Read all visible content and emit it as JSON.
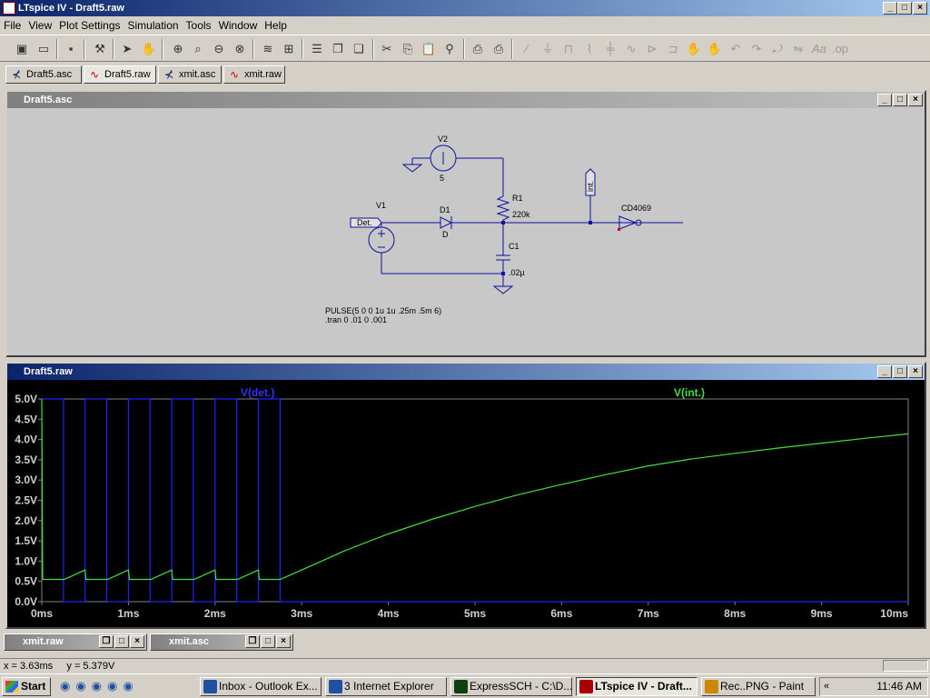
{
  "app": {
    "title": "LTspice IV - Draft5.raw"
  },
  "menu": [
    "File",
    "View",
    "Plot Settings",
    "Simulation",
    "Tools",
    "Window",
    "Help"
  ],
  "tabs": [
    {
      "label": "Draft5.asc",
      "icon": "schematic-icon"
    },
    {
      "label": "Draft5.raw",
      "icon": "waveform-icon"
    },
    {
      "label": "xmit.asc",
      "icon": "schematic-icon"
    },
    {
      "label": "xmit.raw",
      "icon": "waveform-icon"
    }
  ],
  "schematic_window": {
    "title": "Draft5.asc",
    "components": {
      "v2_name": "V2",
      "v2_value": "5",
      "v1_name": "V1",
      "v1_label": "Det.",
      "d1_name": "D1",
      "d1_value": "D",
      "r1_name": "R1",
      "r1_value": "220k",
      "c1_name": "C1",
      "c1_value": ".02µ",
      "int_label": "int.",
      "u1_name": "CD4069"
    },
    "directives": [
      "PULSE(5 0 0 1u 1u .25m .5m 6)",
      ".tran 0 .01 0 .001"
    ]
  },
  "plot_window": {
    "title": "Draft5.raw",
    "trace1_label": "V(det.)",
    "trace2_label": "V(int.)"
  },
  "chart_data": {
    "type": "line",
    "xlabel": "",
    "ylabel": "",
    "xlim": [
      0,
      10
    ],
    "ylim": [
      0,
      5
    ],
    "x_ticks": [
      "0ms",
      "1ms",
      "2ms",
      "3ms",
      "4ms",
      "5ms",
      "6ms",
      "7ms",
      "8ms",
      "9ms",
      "10ms"
    ],
    "y_ticks": [
      "0.0V",
      "0.5V",
      "1.0V",
      "1.5V",
      "2.0V",
      "2.5V",
      "3.0V",
      "3.5V",
      "4.0V",
      "4.5V",
      "5.0V"
    ],
    "grid": false,
    "series": [
      {
        "name": "V(det.)",
        "color": "#2020ff",
        "x": [
          0,
          0.25,
          0.25,
          0.5,
          0.5,
          0.75,
          0.75,
          1.0,
          1.0,
          1.25,
          1.25,
          1.5,
          1.5,
          1.75,
          1.75,
          2.0,
          2.0,
          2.25,
          2.25,
          2.5,
          2.5,
          2.75,
          2.75,
          10
        ],
        "y": [
          5,
          5,
          0,
          0,
          5,
          5,
          0,
          0,
          5,
          5,
          0,
          0,
          5,
          5,
          0,
          0,
          5,
          5,
          0,
          0,
          5,
          5,
          0,
          0
        ]
      },
      {
        "name": "V(int.)",
        "color": "#40e040",
        "x": [
          0,
          0.01,
          0.25,
          0.26,
          0.5,
          0.51,
          0.75,
          0.76,
          1.0,
          1.01,
          1.25,
          1.26,
          1.5,
          1.51,
          1.75,
          1.76,
          2.0,
          2.01,
          2.25,
          2.26,
          2.5,
          2.51,
          2.75,
          3.0,
          3.5,
          4.0,
          4.5,
          5.0,
          5.5,
          6.0,
          6.5,
          7.0,
          7.5,
          8.0,
          8.5,
          9.0,
          9.5,
          10.0
        ],
        "y": [
          5,
          0.55,
          0.55,
          0.55,
          0.78,
          0.55,
          0.55,
          0.55,
          0.78,
          0.55,
          0.55,
          0.55,
          0.78,
          0.55,
          0.55,
          0.55,
          0.78,
          0.55,
          0.55,
          0.55,
          0.78,
          0.55,
          0.55,
          0.78,
          1.26,
          1.67,
          2.03,
          2.35,
          2.64,
          2.89,
          3.13,
          3.35,
          3.52,
          3.66,
          3.79,
          3.91,
          4.03,
          4.14
        ]
      }
    ]
  },
  "minimized": [
    {
      "title": "xmit.raw"
    },
    {
      "title": "xmit.asc"
    }
  ],
  "status": {
    "text": "x = 3.63ms     y = 5.379V"
  },
  "taskbar": {
    "start": "Start",
    "tasks": [
      "Inbox - Outlook Ex...",
      "3 Internet Explorer",
      "ExpressSCH - C:\\D...",
      "LTspice IV - Draft...",
      "Rec..PNG - Paint"
    ],
    "clock": "11:46 AM"
  }
}
